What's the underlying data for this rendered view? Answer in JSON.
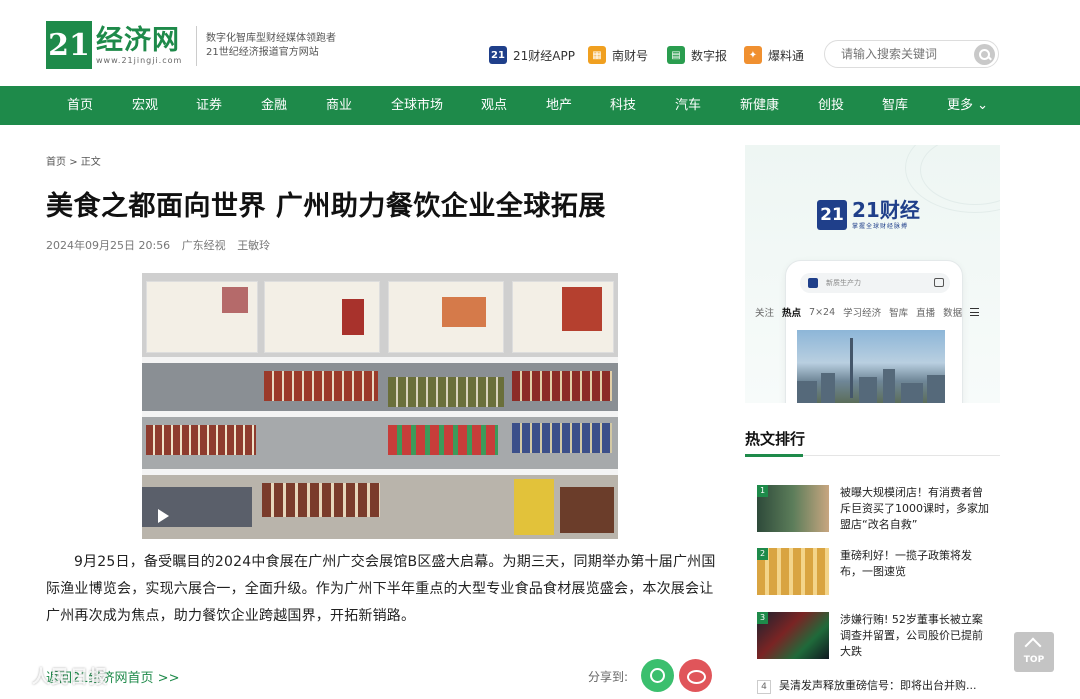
{
  "header": {
    "logo_number": "21",
    "logo_name": "经济网",
    "logo_url": "www.21jingji.com",
    "slogan_line1": "数字化智库型财经媒体领跑者",
    "slogan_line2": "21世纪经济报道官方网站",
    "apps": [
      {
        "label": "21财经APP",
        "icon": "21-app-icon",
        "color": "#1f3f8a"
      },
      {
        "label": "南财号",
        "icon": "nancai-icon",
        "color": "#f0a020"
      },
      {
        "label": "数字报",
        "icon": "digital-paper-icon",
        "color": "#2a9d4f"
      },
      {
        "label": "爆料通",
        "icon": "tipoff-icon",
        "color": "#f09030"
      }
    ],
    "search_placeholder": "请输入搜索关键词"
  },
  "nav": {
    "items": [
      "首页",
      "宏观",
      "证券",
      "金融",
      "商业",
      "全球市场",
      "观点",
      "地产",
      "科技",
      "汽车",
      "新健康",
      "创投",
      "智库"
    ],
    "more": "更多 ⌄"
  },
  "article": {
    "breadcrumb_home": "首页",
    "breadcrumb_sep": ">",
    "breadcrumb_current": "正文",
    "title": "美食之都面向世界 广州助力餐饮企业全球拓展",
    "date": "2024年09月25日 20:56",
    "source": "广东经视",
    "author": "王敏玲",
    "paragraph": "9月25日，备受瞩目的2024中食展在广州广交会展馆B区盛大启幕。为期三天，同期举办第十届广州国际渔业博览会，实现六展合一，全面升级。作为广州下半年重点的大型专业食品食材展览盛会，本次展会让广州再次成为焦点，助力餐饮企业跨越国界，开拓新销路。",
    "back_link": "返回21经济网首页 >>",
    "share_label": "分享到:",
    "watermark": "人民日报"
  },
  "sidebar": {
    "ad_number": "21",
    "ad_brand": "21财经",
    "ad_sub": "掌握全球财经脉搏",
    "ad_search": "新质生产力",
    "ad_tabs": [
      "关注",
      "热点",
      "7×24",
      "学习经济",
      "智库",
      "直播",
      "数据"
    ],
    "ad_active_tab": "热点",
    "hot_title": "热文排行",
    "hot_items": [
      {
        "rank": "1",
        "text": "被曝大规模闭店！有消费者曾斥巨资买了1000课时，多家加盟店“改名自救”"
      },
      {
        "rank": "2",
        "text": "重磅利好！一揽子政策将发布，一图速览"
      },
      {
        "rank": "3",
        "text": "涉嫌行贿! 52岁董事长被立案调查并留置，公司股价已提前大跌"
      },
      {
        "rank": "4",
        "text": "吴清发声释放重磅信号：即将出台并购..."
      }
    ]
  },
  "top_button": "TOP",
  "colors": {
    "brand_green": "#1e8a4a",
    "app_blue": "#1f3f8a"
  }
}
